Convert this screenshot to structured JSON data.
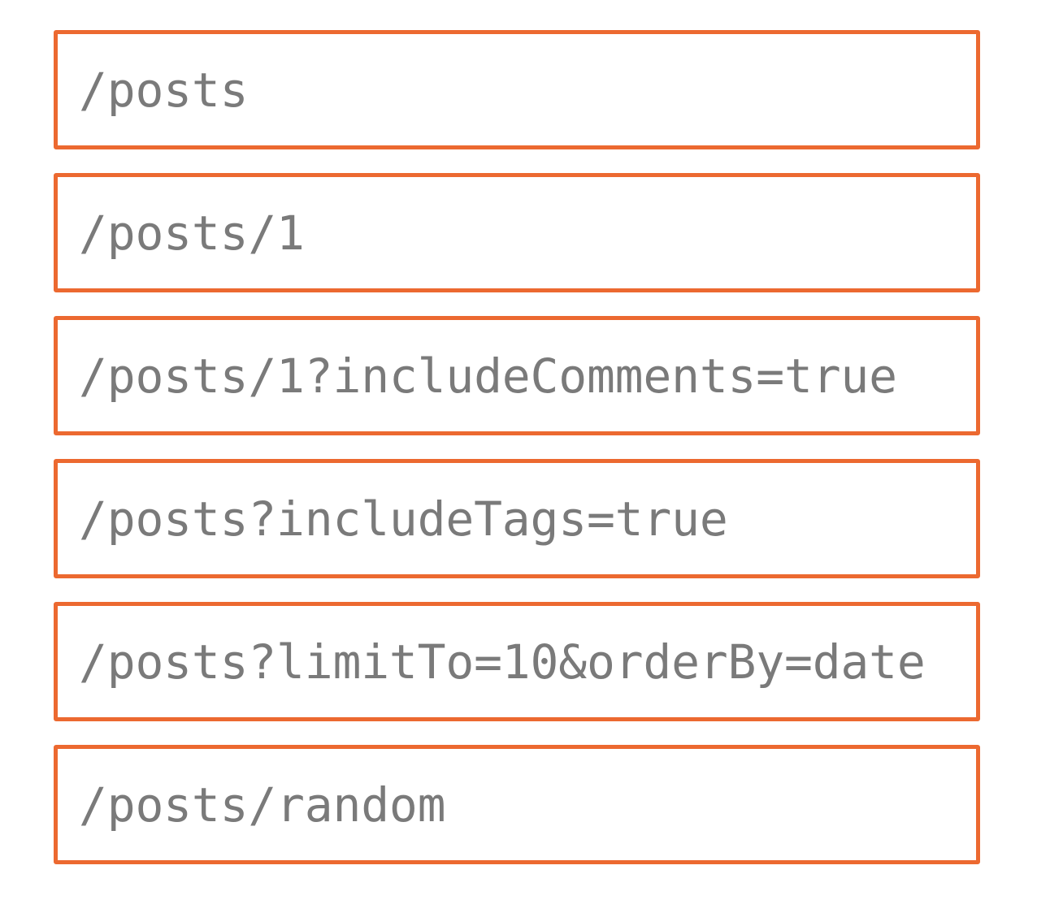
{
  "colors": {
    "border": "#EC6930",
    "text": "#7A7A7A",
    "background": "#FFFFFF"
  },
  "routes": [
    {
      "path": "/posts"
    },
    {
      "path": "/posts/1"
    },
    {
      "path": "/posts/1?includeComments=true"
    },
    {
      "path": "/posts?includeTags=true"
    },
    {
      "path": "/posts?limitTo=10&orderBy=date"
    },
    {
      "path": "/posts/random"
    }
  ]
}
